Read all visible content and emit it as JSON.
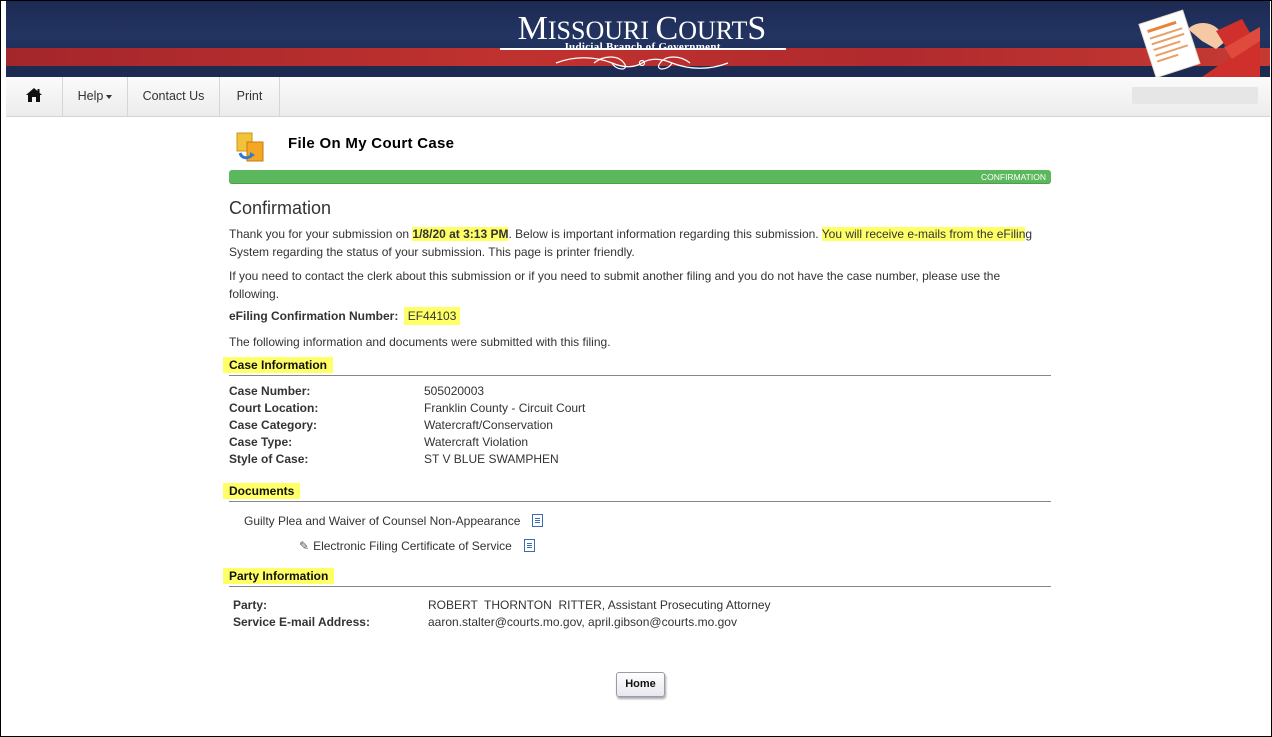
{
  "header": {
    "logo_title_big": "M",
    "logo_title_rest1": "ISSOURI ",
    "logo_title_c": "C",
    "logo_title_rest2": "OURT",
    "logo_title_s": "S",
    "logo_subtitle": "Judicial Branch of Government"
  },
  "nav": {
    "home_icon": "home-icon",
    "help": "Help",
    "contact": "Contact Us",
    "print": "Print"
  },
  "page": {
    "title": "File On My Court Case",
    "progress_label": "CONFIRMATION",
    "heading": "Confirmation",
    "p1_a": "Thank you for your submission on ",
    "p1_date": "1/8/20 at 3:13 PM",
    "p1_b": ". Below is important information regarding this submission. ",
    "p1_hl": "You will receive e-mails from the eFilin",
    "p1_c": "g System regarding the status of your submission. This page is printer friendly.",
    "p2": "If you need to contact the clerk about this submission or if you need to submit another filing and you do not have the case number, please use the following.",
    "conf_label": "eFiling Confirmation Number:",
    "conf_value": "EF44103",
    "p3": "The following information and documents were submitted with this filing."
  },
  "case_info": {
    "heading": "Case Information",
    "rows": [
      {
        "label": "Case Number:",
        "value": "505020003"
      },
      {
        "label": "Court Location:",
        "value": "Franklin County - Circuit Court"
      },
      {
        "label": "Case Category:",
        "value": "Watercraft/Conservation"
      },
      {
        "label": "Case Type:",
        "value": "Watercraft Violation"
      },
      {
        "label": "Style of Case:",
        "value": "ST V BLUE SWAMPHEN"
      }
    ]
  },
  "documents": {
    "heading": "Documents",
    "items": [
      {
        "name": "Guilty Plea and Waiver of Counsel Non-Appearance",
        "icon": "document-icon"
      },
      {
        "name": "Electronic Filing Certificate of Service",
        "icon": "document-icon",
        "attachment_icon": "paperclip-icon"
      }
    ]
  },
  "party_info": {
    "heading": "Party Information",
    "rows": [
      {
        "label": "Party:",
        "value": "ROBERT  THORNTON  RITTER, Assistant Prosecuting Attorney"
      },
      {
        "label": "Service E-mail Address:",
        "value": "aaron.stalter@courts.mo.gov, april.gibson@courts.mo.gov"
      }
    ]
  },
  "footer": {
    "home_button": "Home"
  },
  "colors": {
    "banner_navy": "#1d2a52",
    "banner_red": "#c0322f",
    "progress_green": "#5cb85c",
    "highlight_yellow": "#ffff66"
  }
}
